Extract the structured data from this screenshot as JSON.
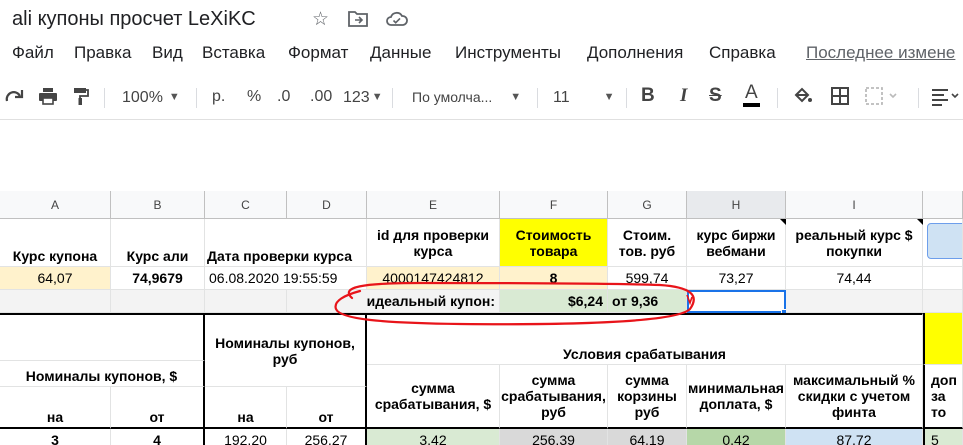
{
  "doc": {
    "title": "ali купоны просчет LeXiKC",
    "star_icon": "star-icon",
    "move_icon": "move-to-folder-icon",
    "cloud_icon": "cloud-status-icon"
  },
  "menu": {
    "items": [
      "Файл",
      "Правка",
      "Вид",
      "Вставка",
      "Формат",
      "Данные",
      "Инструменты",
      "Дополнения",
      "Справка"
    ],
    "last_edit": "Последнее измене"
  },
  "toolbar": {
    "zoom": "100%",
    "currency": "р.",
    "percent": "%",
    "dec_less": ".0",
    "dec_more": ".00",
    "format_more": "123",
    "font": "По умолча...",
    "size": "11",
    "bold": "B",
    "italic": "I",
    "strike": "S",
    "text_color": "A"
  },
  "columns": [
    "A",
    "B",
    "C",
    "D",
    "E",
    "F",
    "G",
    "H",
    "I"
  ],
  "row1": {
    "a": "Курс купона",
    "b": "Курс али",
    "cd": "Дата проверки курса",
    "e": "id для проверки курса",
    "f": "Стоимость товара",
    "g": "Стоим. тов. руб",
    "h": "курс биржи вебмани",
    "i": "реальный курс $ покупки"
  },
  "row2": {
    "a": "64,07",
    "b": "74,9679",
    "cd": "06.08.2020 19:55:59",
    "e": "4000147424812",
    "f": "8",
    "g": "599,74",
    "h": "73,27",
    "i": "74,44"
  },
  "row3": {
    "label": "идеальный купон:",
    "f": "$6,24",
    "g": "от 9,36"
  },
  "table2": {
    "nom_usd": "Номиналы купонов, $",
    "nom_rub": "Номиналы купонов, руб",
    "conditions": "Условия срабатывания",
    "e": "сумма срабатывания, $",
    "f": "сумма срабатывания, руб",
    "g": "сумма корзины руб",
    "h": "минимальная доплата, $",
    "i": "максимальный % скидки с учетом финта",
    "j": "доп за то",
    "na1": "на",
    "ot1": "от",
    "na2": "на",
    "ot2": "от"
  },
  "row_data": {
    "a": "3",
    "b": "4",
    "c": "192,20",
    "d": "256,27",
    "e": "3,42",
    "f": "256,39",
    "g": "64,19",
    "h": "0,42",
    "i": "87,72",
    "j": "5"
  },
  "colors": {
    "yellow": "#ffff00",
    "light_yellow": "#fff2cc",
    "light_green": "#d9ead3",
    "green_cell": "#b6d7a8",
    "blue_cell": "#cfe2f3",
    "gray_cell": "#d9d9d9",
    "annotation_red": "#e8141a"
  }
}
